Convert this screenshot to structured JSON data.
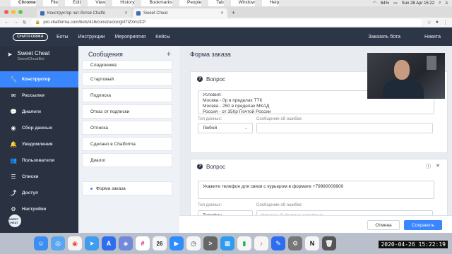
{
  "menubar": {
    "app": "Chrome",
    "items": [
      "File",
      "Edit",
      "View",
      "History",
      "Bookmarks",
      "People",
      "Tab",
      "Window",
      "Help"
    ],
    "battery": "64%",
    "clock": "Sun 26 Apr 15:22"
  },
  "browser": {
    "tabs": [
      {
        "title": "Конструктор чат-ботов Chatfo"
      },
      {
        "title": "Sweet Cheat"
      }
    ],
    "url": "pro.chatforma.com/bots/416/constructor/gnlTlZXmJCP"
  },
  "header": {
    "logo": "CHATFORMA",
    "nav": [
      "Боты",
      "Инструкции",
      "Мероприятия",
      "Кейсы"
    ],
    "order_bot": "Заказать бота",
    "user": "Никита"
  },
  "sidebar": {
    "bot_name": "Sweet Cheat",
    "bot_handle": "SweetCheatBot",
    "items": [
      {
        "label": "Конструктор",
        "icon": "wrench-icon"
      },
      {
        "label": "Рассылки",
        "icon": "mail-icon"
      },
      {
        "label": "Диалоги",
        "icon": "chat-icon"
      },
      {
        "label": "Сбор данных",
        "icon": "data-icon"
      },
      {
        "label": "Уведомления",
        "icon": "bell-icon"
      },
      {
        "label": "Пользователи",
        "icon": "users-icon"
      },
      {
        "label": "Списки",
        "icon": "list-icon"
      },
      {
        "label": "Доступ",
        "icon": "share-icon"
      },
      {
        "label": "Настройки",
        "icon": "gear-icon"
      }
    ],
    "avatar_text": "SWEET CHEAT"
  },
  "messages": {
    "title": "Сообщения",
    "items": [
      "Сладкоежка",
      "Стартовый",
      "Подписка",
      "Отказ от подписки",
      "Отписка",
      "Сделано в Chatforma",
      "Диалог",
      "Форма заказа"
    ]
  },
  "form": {
    "title": "Форма заказа",
    "questions": [
      {
        "label": "Вопрос",
        "text": "Условия:\nМосква - 0р в пределах ТТК\nМосква - 250 в пределах МКАД\nРоссия - от 350р Почтой России",
        "type_label": "Тип данных:",
        "type_value": "Любой",
        "error_label": "Сообщение об ошибке:"
      },
      {
        "label": "Вопрос",
        "text": "Укажите телефон для связи с курьером в формате +79990009900",
        "type_label": "Тип данных:",
        "type_value": "Телефон",
        "error_label": "Сообщение об ошибке:",
        "error_value": "Неверный формат телефона"
      }
    ],
    "cancel": "Отмена",
    "save": "Сохранить"
  },
  "dock": {
    "datetime": "2020-04-26  15:22:19",
    "calendar_day": "26"
  }
}
